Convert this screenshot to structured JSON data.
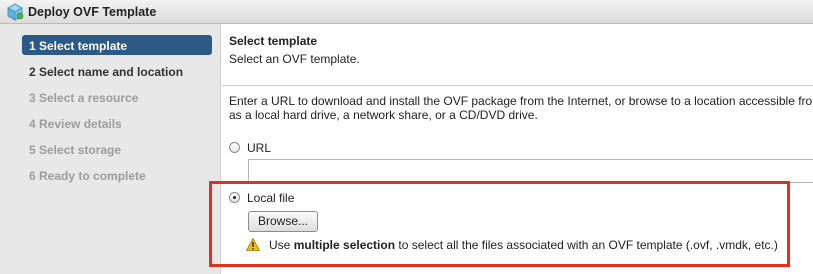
{
  "window": {
    "title": "Deploy OVF Template"
  },
  "steps": [
    {
      "label": "1  Select template",
      "state": "active"
    },
    {
      "label": "2  Select name and location",
      "state": "next"
    },
    {
      "label": "3  Select a resource",
      "state": "disabled"
    },
    {
      "label": "4  Review details",
      "state": "disabled"
    },
    {
      "label": "5  Select storage",
      "state": "disabled"
    },
    {
      "label": "6  Ready to complete",
      "state": "disabled"
    }
  ],
  "main": {
    "title": "Select template",
    "subtitle": "Select an OVF template.",
    "description_line1": "Enter a URL to download and install the OVF package from the Internet, or browse to a location accessible fro",
    "description_line2": "as a local hard drive, a network share, or a CD/DVD drive.",
    "url_option": {
      "label": "URL",
      "selected": false,
      "value": ""
    },
    "local_option": {
      "label": "Local file",
      "selected": true
    },
    "browse_label": "Browse...",
    "warning": {
      "prefix": "Use ",
      "bold": "multiple selection",
      "suffix": " to select all the files associated with an OVF template (.ovf, .vmdk, etc.)"
    }
  },
  "colors": {
    "active_step": "#2b5a86",
    "highlight_border": "#e0301e",
    "warning_icon": "#f2c200"
  },
  "icons": {
    "app": "ovf-package-icon",
    "warning": "warning-icon"
  }
}
